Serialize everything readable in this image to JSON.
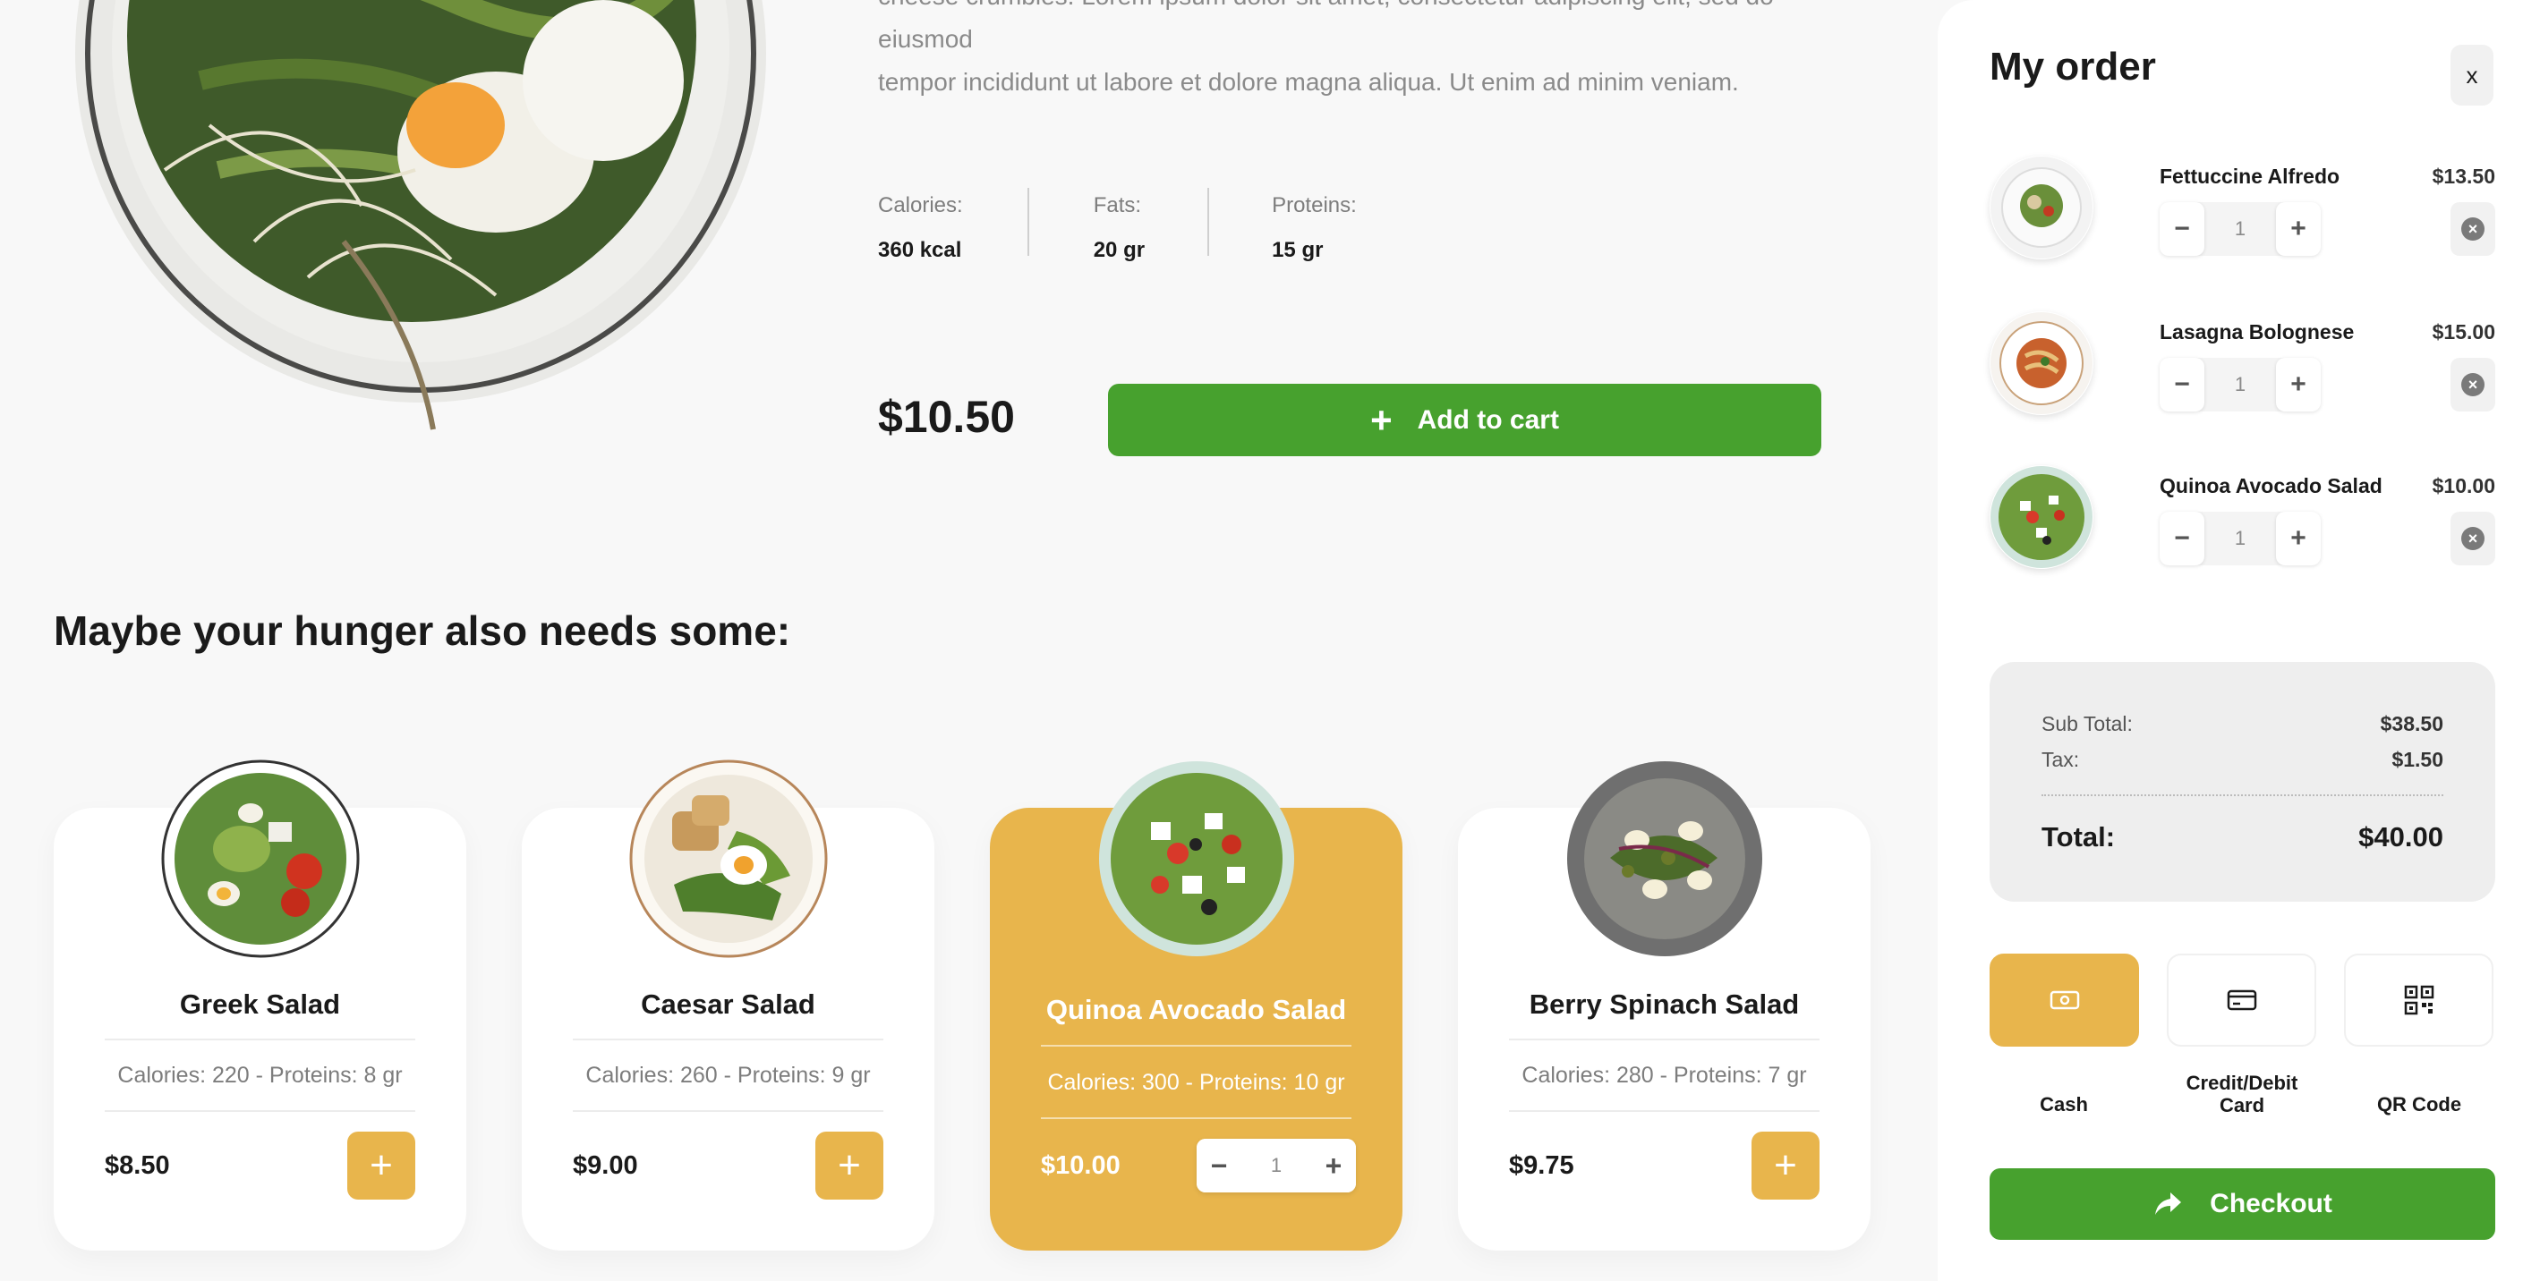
{
  "product": {
    "description_line1": "cheese crumbles. Lorem ipsum dolor sit amet, consectetur adipiscing elit, sed do eiusmod",
    "description_line2": "tempor incididunt ut labore et dolore magna aliqua. Ut enim ad minim veniam.",
    "nutrition": [
      {
        "label": "Calories:",
        "value": "360 kcal"
      },
      {
        "label": "Fats:",
        "value": "20 gr"
      },
      {
        "label": "Proteins:",
        "value": "15 gr"
      }
    ],
    "price": "$10.50",
    "add_to_cart_label": "Add to cart"
  },
  "suggestions": {
    "title": "Maybe your hunger also needs some:",
    "cards": [
      {
        "name": "Greek Salad",
        "meta": "Calories: 220 - Proteins: 8 gr",
        "price": "$8.50"
      },
      {
        "name": "Caesar Salad",
        "meta": "Calories: 260 - Proteins: 9 gr",
        "price": "$9.00"
      },
      {
        "name": "Quinoa Avocado Salad",
        "meta": "Calories: 300 - Proteins: 10 gr",
        "price": "$10.00",
        "qty": "1"
      },
      {
        "name": "Berry Spinach Salad",
        "meta": "Calories: 280 - Proteins: 7 gr",
        "price": "$9.75"
      }
    ],
    "add_symbol": "+"
  },
  "order": {
    "title": "My order",
    "close_label": "x",
    "items": [
      {
        "name": "Fettuccine Alfredo",
        "price": "$13.50",
        "qty": "1"
      },
      {
        "name": "Lasagna Bolognese",
        "price": "$15.00",
        "qty": "1"
      },
      {
        "name": "Quinoa Avocado Salad",
        "price": "$10.00",
        "qty": "1"
      }
    ],
    "summary": {
      "subtotal_label": "Sub Total:",
      "subtotal": "$38.50",
      "tax_label": "Tax:",
      "tax": "$1.50",
      "total_label": "Total:",
      "total": "$40.00"
    },
    "payment_methods": [
      {
        "label": "Cash",
        "icon": "cash-icon",
        "selected": true
      },
      {
        "label_line1": "Credit/Debit",
        "label_line2": "Card",
        "icon": "credit-card-icon"
      },
      {
        "label": "QR Code",
        "icon": "qr-code-icon"
      }
    ],
    "checkout_label": "Checkout"
  },
  "colors": {
    "accent_green": "#47a12e",
    "accent_yellow": "#e8b54c",
    "background": "#f8f8f8"
  }
}
